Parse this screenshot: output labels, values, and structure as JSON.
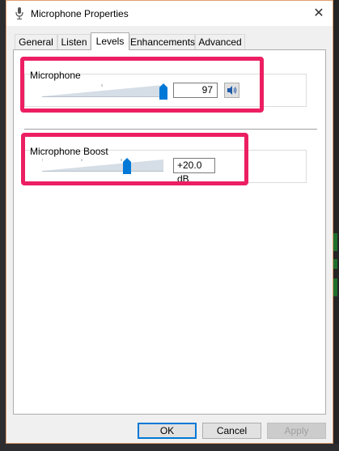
{
  "window": {
    "title": "Microphone Properties",
    "close_glyph": "✕"
  },
  "tabs": [
    {
      "label": "General",
      "active": false
    },
    {
      "label": "Listen",
      "active": false
    },
    {
      "label": "Levels",
      "active": true
    },
    {
      "label": "Enhancements",
      "active": false
    },
    {
      "label": "Advanced",
      "active": false
    }
  ],
  "levels": {
    "microphone": {
      "label": "Microphone",
      "value": "97",
      "level_percent": 97,
      "speaker_icon": "speaker-icon"
    },
    "boost": {
      "label": "Microphone Boost",
      "value": "+20.0 dB",
      "level_fraction": 0.67
    }
  },
  "buttons": {
    "ok": "OK",
    "cancel": "Cancel",
    "apply": "Apply"
  },
  "colors": {
    "highlight": "#ec1f63",
    "accent": "#0078d7"
  }
}
